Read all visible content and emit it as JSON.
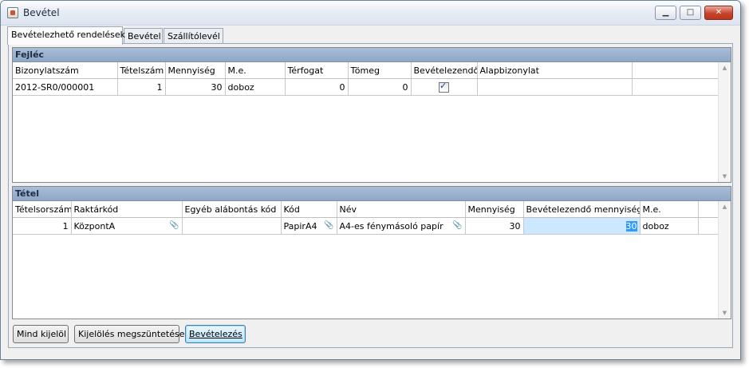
{
  "window": {
    "title": "Bevétel",
    "min": "▁",
    "max": "□",
    "close": "✕"
  },
  "tabs": [
    "Bevételezhető rendelések",
    "Bevétel",
    "Szállítólevél"
  ],
  "header_section": {
    "title": "Fejléc",
    "columns": [
      "Bizonylatszám",
      "Tételszám",
      "Mennyiség",
      "M.e.",
      "Térfogat",
      "Tömeg",
      "Bevételezendő",
      "Alapbizonylat"
    ],
    "rows": [
      {
        "doc_no": "2012-SR0/000001",
        "item_no": "1",
        "qty": "30",
        "unit": "doboz",
        "volume": "0",
        "weight": "0",
        "to_receive": true,
        "base_doc": ""
      }
    ]
  },
  "items_section": {
    "title": "Tétel",
    "columns": [
      "Tételsorszám",
      "Raktárkód",
      "Egyéb alábontás kód",
      "Kód",
      "Név",
      "Mennyiség",
      "Bevételezendő mennyiség",
      "M.e."
    ],
    "rows": [
      {
        "line_no": "1",
        "warehouse": "KözpontA",
        "other_code": "",
        "code": "PapirA4",
        "name": "A4-es fénymásoló papír",
        "qty": "30",
        "to_receive_qty": "30",
        "unit": "doboz"
      }
    ]
  },
  "buttons": {
    "select_all": "Mind kijelöl",
    "deselect": "Kijelölés megszüntetése",
    "receive": "Bevételezés"
  },
  "icons": {
    "attachment": "paperclip-icon",
    "checkbox": "checkbox-checked-icon"
  },
  "colors": {
    "section_header": "#9fb5d2",
    "edit_cell": "#cce8ff",
    "selection": "#3399ff"
  }
}
